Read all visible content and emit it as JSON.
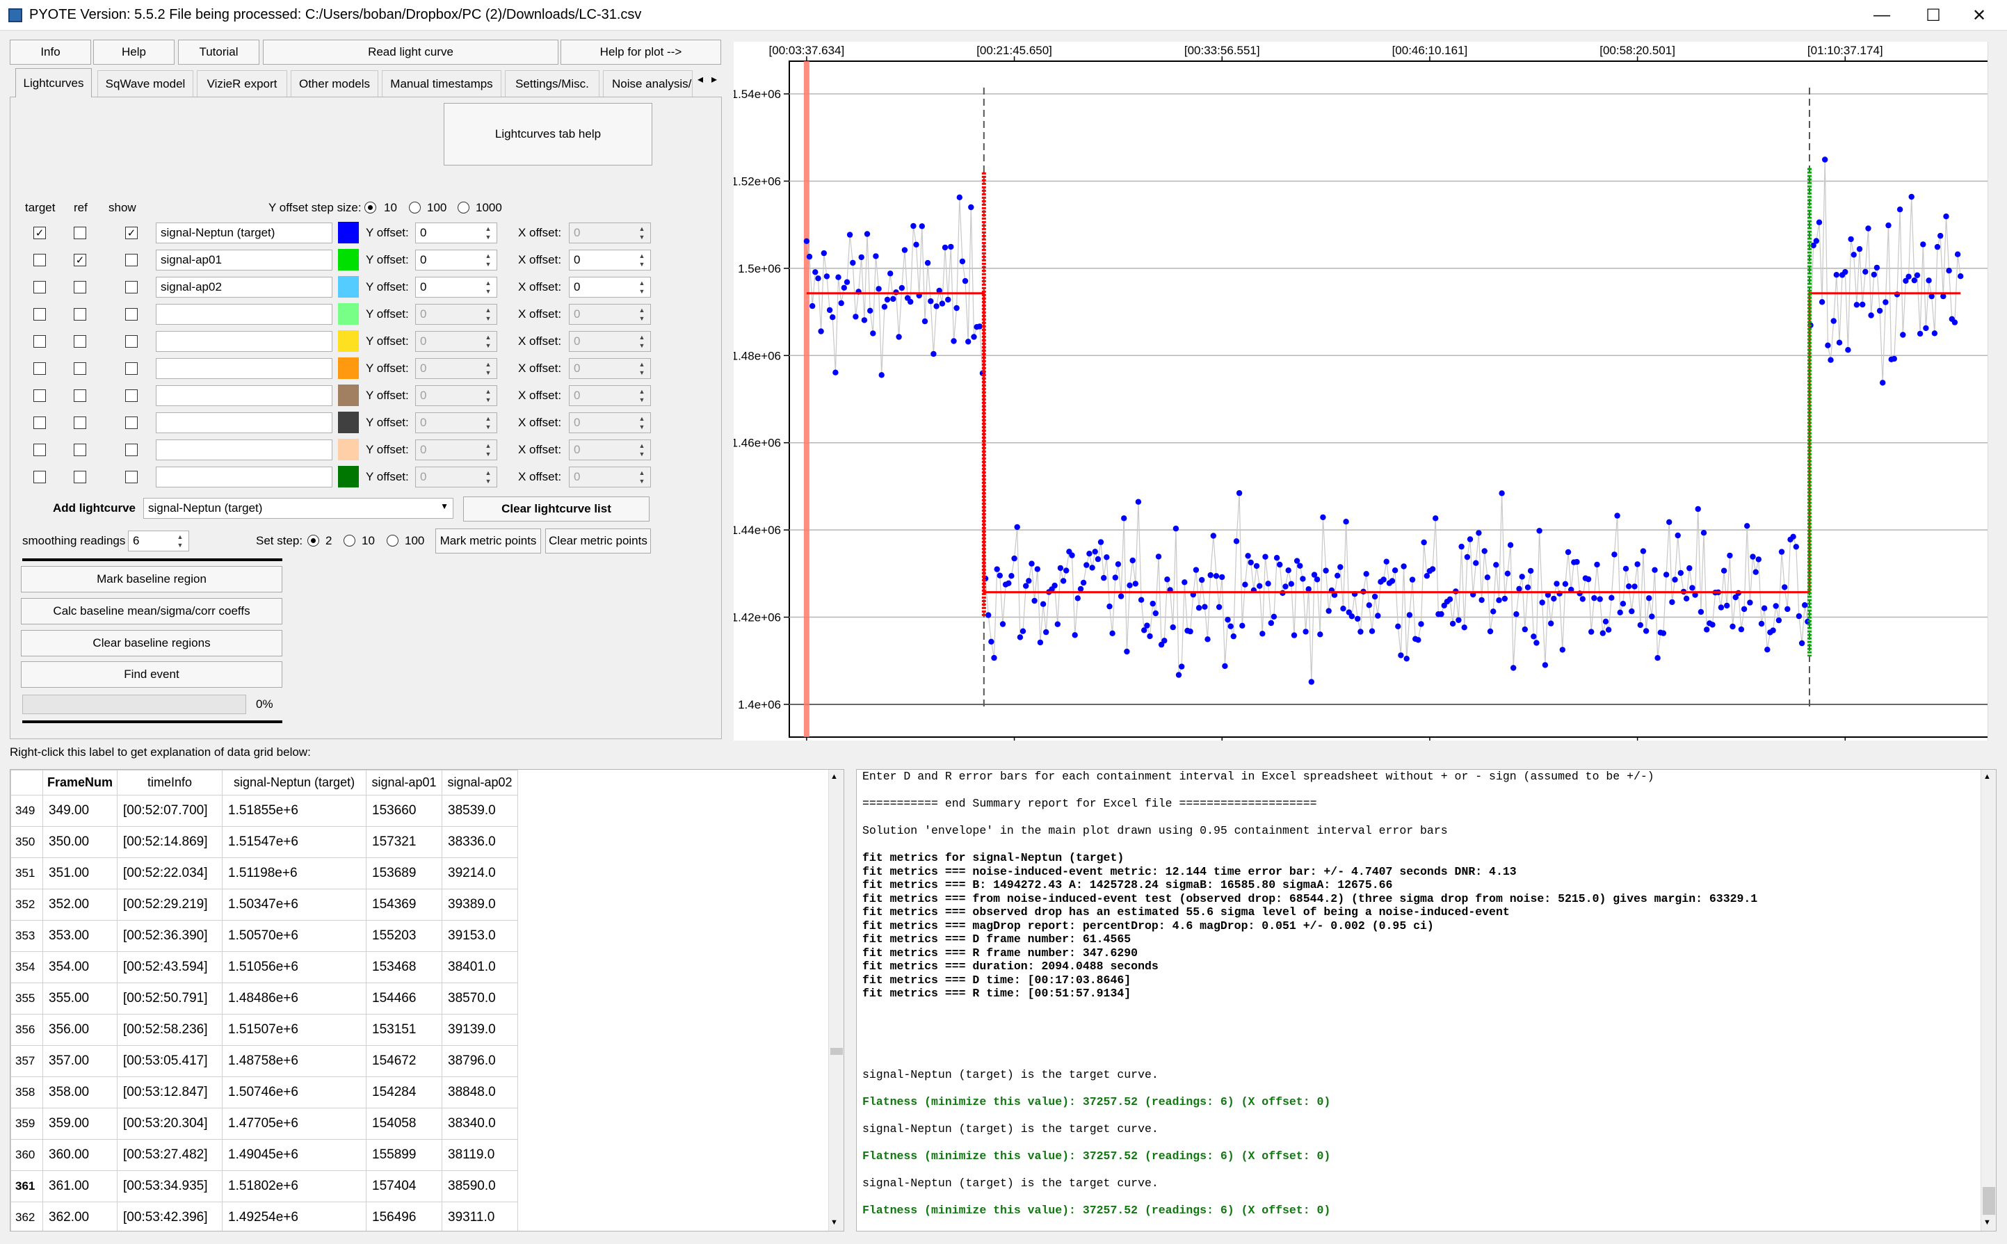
{
  "window": {
    "title": "PYOTE Version: 5.5.2  File being processed: C:/Users/boban/Dropbox/PC (2)/Downloads/LC-31.csv",
    "minimize": "—",
    "maximize": "☐",
    "close": "✕"
  },
  "top_buttons": {
    "info": "Info",
    "help": "Help",
    "tutorial": "Tutorial",
    "read_light_curve": "Read light curve",
    "help_for_plot": "Help for plot -->"
  },
  "tabs": [
    "Lightcurves",
    "SqWave model",
    "VizieR export",
    "Other models",
    "Manual timestamps",
    "Settings/Misc.",
    "Noise analysis/I"
  ],
  "tab_scroll": [
    "◂",
    "▸"
  ],
  "lightcurves_tab": {
    "help_button": "Lightcurves tab help",
    "col_target": "target",
    "col_ref": "ref",
    "col_show": "show",
    "y_step_label": "Y offset step size:",
    "y_step_options": [
      "10",
      "100",
      "1000"
    ],
    "y_step_selected": "10",
    "y_offset_label": "Y offset:",
    "x_offset_label": "X offset:",
    "rows": [
      {
        "target": true,
        "ref": false,
        "show": true,
        "name": "signal-Neptun (target)",
        "color": "#0000ff",
        "y": "0",
        "x": "0",
        "x_enabled": false
      },
      {
        "target": false,
        "ref": true,
        "show": false,
        "name": "signal-ap01",
        "color": "#00e000",
        "y": "0",
        "x": "0",
        "x_enabled": true
      },
      {
        "target": false,
        "ref": false,
        "show": false,
        "name": "signal-ap02",
        "color": "#55ccff",
        "y": "0",
        "x": "0",
        "x_enabled": true
      },
      {
        "target": false,
        "ref": false,
        "show": false,
        "name": "",
        "color": "#77ff88",
        "y": "0",
        "x": "0",
        "x_enabled": false
      },
      {
        "target": false,
        "ref": false,
        "show": false,
        "name": "",
        "color": "#ffe020",
        "y": "0",
        "x": "0",
        "x_enabled": false
      },
      {
        "target": false,
        "ref": false,
        "show": false,
        "name": "",
        "color": "#ff9910",
        "y": "0",
        "x": "0",
        "x_enabled": false
      },
      {
        "target": false,
        "ref": false,
        "show": false,
        "name": "",
        "color": "#a08060",
        "y": "0",
        "x": "0",
        "x_enabled": false
      },
      {
        "target": false,
        "ref": false,
        "show": false,
        "name": "",
        "color": "#404040",
        "y": "0",
        "x": "0",
        "x_enabled": false
      },
      {
        "target": false,
        "ref": false,
        "show": false,
        "name": "",
        "color": "#ffd0a8",
        "y": "0",
        "x": "0",
        "x_enabled": false
      },
      {
        "target": false,
        "ref": false,
        "show": false,
        "name": "",
        "color": "#007700",
        "y": "0",
        "x": "0",
        "x_enabled": false
      }
    ],
    "add_lightcurve_label": "Add lightcurve",
    "add_lightcurve_value": "signal-Neptun (target)",
    "clear_lightcurve_list": "Clear lightcurve list",
    "smoothing_label": "smoothing readings",
    "smoothing_value": "6",
    "set_step_label": "Set step:",
    "set_step_options": [
      "2",
      "10",
      "100"
    ],
    "set_step_selected": "2",
    "mark_metric_points": "Mark metric points",
    "clear_metric_points": "Clear metric points",
    "mark_baseline_region": "Mark baseline region",
    "calc_baseline": "Calc baseline mean/sigma/corr coeffs",
    "clear_baseline_regions": "Clear baseline regions",
    "find_event": "Find event",
    "progress_value": 0,
    "progress_text": "0%"
  },
  "grid_hint": "Right-click this label to get explanation of data grid below:",
  "table": {
    "headers": [
      "FrameNum",
      "timeInfo",
      "signal-Neptun (target)",
      "signal-ap01",
      "signal-ap02"
    ],
    "rows": [
      [
        "349",
        "349.00",
        "[00:52:07.700]",
        "1.51855e+6",
        "153660",
        "38539.0"
      ],
      [
        "350",
        "350.00",
        "[00:52:14.869]",
        "1.51547e+6",
        "157321",
        "38336.0"
      ],
      [
        "351",
        "351.00",
        "[00:52:22.034]",
        "1.51198e+6",
        "153689",
        "39214.0"
      ],
      [
        "352",
        "352.00",
        "[00:52:29.219]",
        "1.50347e+6",
        "154369",
        "39389.0"
      ],
      [
        "353",
        "353.00",
        "[00:52:36.390]",
        "1.50570e+6",
        "155203",
        "39153.0"
      ],
      [
        "354",
        "354.00",
        "[00:52:43.594]",
        "1.51056e+6",
        "153468",
        "38401.0"
      ],
      [
        "355",
        "355.00",
        "[00:52:50.791]",
        "1.48486e+6",
        "154466",
        "38570.0"
      ],
      [
        "356",
        "356.00",
        "[00:52:58.236]",
        "1.51507e+6",
        "153151",
        "39139.0"
      ],
      [
        "357",
        "357.00",
        "[00:53:05.417]",
        "1.48758e+6",
        "154672",
        "38796.0"
      ],
      [
        "358",
        "358.00",
        "[00:53:12.847]",
        "1.50746e+6",
        "154284",
        "38848.0"
      ],
      [
        "359",
        "359.00",
        "[00:53:20.304]",
        "1.47705e+6",
        "154058",
        "38340.0"
      ],
      [
        "360",
        "360.00",
        "[00:53:27.482]",
        "1.49045e+6",
        "155899",
        "38119.0"
      ],
      [
        "361",
        "361.00",
        "[00:53:34.935]",
        "1.51802e+6",
        "157404",
        "38590.0"
      ],
      [
        "362",
        "362.00",
        "[00:53:42.396]",
        "1.49254e+6",
        "156496",
        "39311.0"
      ]
    ]
  },
  "log": [
    {
      "t": "Enter D and R error bars for each containment interval in Excel spreadsheet without + or - sign (assumed to be +/-)",
      "s": ""
    },
    {
      "t": "",
      "s": ""
    },
    {
      "t": "=========== end Summary report for Excel file ====================",
      "s": ""
    },
    {
      "t": "",
      "s": ""
    },
    {
      "t": "Solution 'envelope' in the main plot drawn using 0.95 containment interval error bars",
      "s": ""
    },
    {
      "t": "",
      "s": ""
    },
    {
      "t": "fit metrics for signal-Neptun (target)",
      "s": "b"
    },
    {
      "t": "fit metrics === noise-induced-event metric: 12.144 time error bar: +/- 4.7407 seconds DNR: 4.13",
      "s": "b"
    },
    {
      "t": "fit metrics === B: 1494272.43 A: 1425728.24 sigmaB: 16585.80 sigmaA: 12675.66",
      "s": "b"
    },
    {
      "t": "fit metrics === from noise-induced-event test (observed drop: 68544.2) (three sigma drop from noise: 5215.0) gives margin: 63329.1",
      "s": "b"
    },
    {
      "t": "fit metrics === observed drop has an estimated 55.6 sigma level of being a noise-induced-event",
      "s": "b"
    },
    {
      "t": "fit metrics === magDrop report: percentDrop: 4.6 magDrop: 0.051 +/- 0.002 (0.95 ci)",
      "s": "b"
    },
    {
      "t": "fit metrics === D frame number: 61.4565",
      "s": "b"
    },
    {
      "t": "fit metrics === R frame number: 347.6290",
      "s": "b"
    },
    {
      "t": "fit metrics === duration: 2094.0488 seconds",
      "s": "b"
    },
    {
      "t": "fit metrics === D time: [00:17:03.8646]",
      "s": "b"
    },
    {
      "t": "fit metrics === R time: [00:51:57.9134]",
      "s": "b"
    },
    {
      "t": "",
      "s": ""
    },
    {
      "t": "",
      "s": ""
    },
    {
      "t": "",
      "s": ""
    },
    {
      "t": "",
      "s": ""
    },
    {
      "t": "",
      "s": ""
    },
    {
      "t": "signal-Neptun (target) is the target curve.",
      "s": ""
    },
    {
      "t": "",
      "s": ""
    },
    {
      "t": "Flatness (minimize this value): 37257.52 (readings: 6) (X offset: 0)",
      "s": "g"
    },
    {
      "t": "",
      "s": ""
    },
    {
      "t": "signal-Neptun (target) is the target curve.",
      "s": ""
    },
    {
      "t": "",
      "s": ""
    },
    {
      "t": "Flatness (minimize this value): 37257.52 (readings: 6) (X offset: 0)",
      "s": "g"
    },
    {
      "t": "",
      "s": ""
    },
    {
      "t": "signal-Neptun (target) is the target curve.",
      "s": ""
    },
    {
      "t": "",
      "s": ""
    },
    {
      "t": "Flatness (minimize this value): 37257.52 (readings: 6) (X offset: 0)",
      "s": "g"
    }
  ],
  "chart_data": {
    "type": "scatter",
    "title": "",
    "xlabel": "",
    "ylabel": "",
    "x_tick_labels": [
      "[00:03:37.634]",
      "[00:21:45.650]",
      "[00:33:56.551]",
      "[00:46:10.161]",
      "[00:58:20.501]",
      "[01:10:37.174]"
    ],
    "x_tick_frames": [
      0,
      72,
      144,
      216,
      288,
      360
    ],
    "xlim": [
      -6,
      412
    ],
    "y_tick_labels": [
      "1.4e+06",
      "1.42e+06",
      "1.44e+06",
      "1.46e+06",
      "1.48e+06",
      "1.5e+06",
      "1.52e+06",
      "1.54e+06"
    ],
    "ylim": [
      1392500,
      1547500
    ],
    "grid": true,
    "series": [
      {
        "role": "target readings",
        "color": "#0000ff",
        "segments": [
          {
            "x_start": 0,
            "x_end": 60,
            "mean": 1494000,
            "sd": 13000
          },
          {
            "x_start": 44,
            "x_end": 257,
            "mean": 1426000,
            "sd": 11500
          },
          {
            "x_start": 258,
            "x_end": 400,
            "mean": 1494000,
            "sd": 17000
          }
        ]
      }
    ],
    "model_fit": {
      "color": "#ff0000",
      "B": 1494272.43,
      "A": 1425728.24,
      "D_frame": 61.4565,
      "R_frame": 347.629,
      "x_end": 400
    },
    "D_edge_color": "#ff0000",
    "R_edge_color": "#00aa00",
    "baseline_region_color": "#ff7a6a"
  }
}
